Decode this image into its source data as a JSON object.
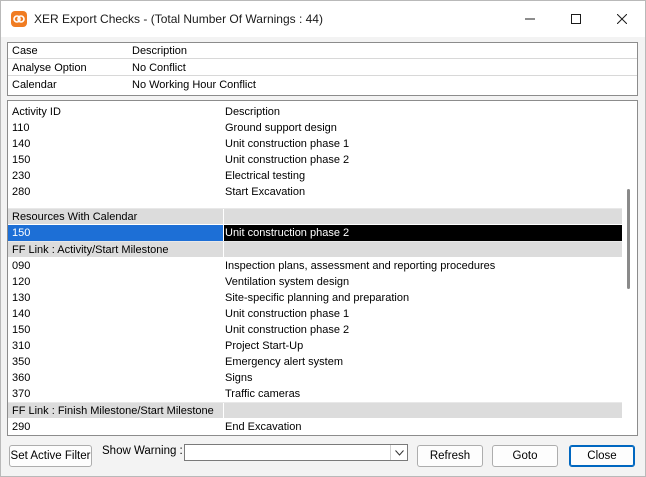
{
  "window": {
    "title": "XER Export Checks - (Total Number Of Warnings : 44)"
  },
  "info": {
    "rows": [
      {
        "label": "Case",
        "value": "Description"
      },
      {
        "label": "Analyse Option",
        "value": "No Conflict"
      },
      {
        "label": "Calendar",
        "value": "No Working Hour Conflict"
      }
    ]
  },
  "list": {
    "header": {
      "col1": "Activity ID",
      "col2": "Description"
    },
    "rows": [
      {
        "type": "item",
        "id": "110",
        "desc": "Ground support design"
      },
      {
        "type": "item",
        "id": "140",
        "desc": "Unit construction phase 1"
      },
      {
        "type": "item",
        "id": "150",
        "desc": "Unit construction phase 2"
      },
      {
        "type": "item",
        "id": "230",
        "desc": "Electrical testing"
      },
      {
        "type": "item",
        "id": "280",
        "desc": "Start Excavation"
      },
      {
        "type": "spacer"
      },
      {
        "type": "group",
        "id": "Resources With Calendar",
        "desc": ""
      },
      {
        "type": "selected",
        "id": "150",
        "desc": "Unit construction phase 2"
      },
      {
        "type": "group",
        "id": "FF Link : Activity/Start Milestone",
        "desc": ""
      },
      {
        "type": "item",
        "id": "090",
        "desc": "Inspection plans, assessment and reporting procedures"
      },
      {
        "type": "item",
        "id": "120",
        "desc": "Ventilation system design"
      },
      {
        "type": "item",
        "id": "130",
        "desc": "Site-specific planning and preparation"
      },
      {
        "type": "item",
        "id": "140",
        "desc": "Unit construction phase 1"
      },
      {
        "type": "item",
        "id": "150",
        "desc": "Unit construction phase 2"
      },
      {
        "type": "item",
        "id": "310",
        "desc": "Project Start-Up"
      },
      {
        "type": "item",
        "id": "350",
        "desc": "Emergency alert system"
      },
      {
        "type": "item",
        "id": "360",
        "desc": "Signs"
      },
      {
        "type": "item",
        "id": "370",
        "desc": "Traffic cameras"
      },
      {
        "type": "group",
        "id": "FF Link : Finish Milestone/Start  Milestone",
        "desc": ""
      },
      {
        "type": "item",
        "id": "290",
        "desc": "End Excavation"
      }
    ]
  },
  "controls": {
    "set_filter_label": "Set Active Filter",
    "show_warning_label": "Show Warning :",
    "show_warning_value": "",
    "refresh_label": "Refresh",
    "goto_label": "Goto",
    "close_label": "Close"
  },
  "icons": {
    "app": "app-logo-icon",
    "minimize": "minimize-icon",
    "maximize": "maximize-icon",
    "close": "close-icon",
    "dropdown": "chevron-down-icon"
  },
  "colors": {
    "selection": "#000000",
    "selection_accent": "#1d6fd6",
    "group_band": "#dcdcdc",
    "app_icon": "#f07c22",
    "default_button_border": "#0067c0"
  }
}
